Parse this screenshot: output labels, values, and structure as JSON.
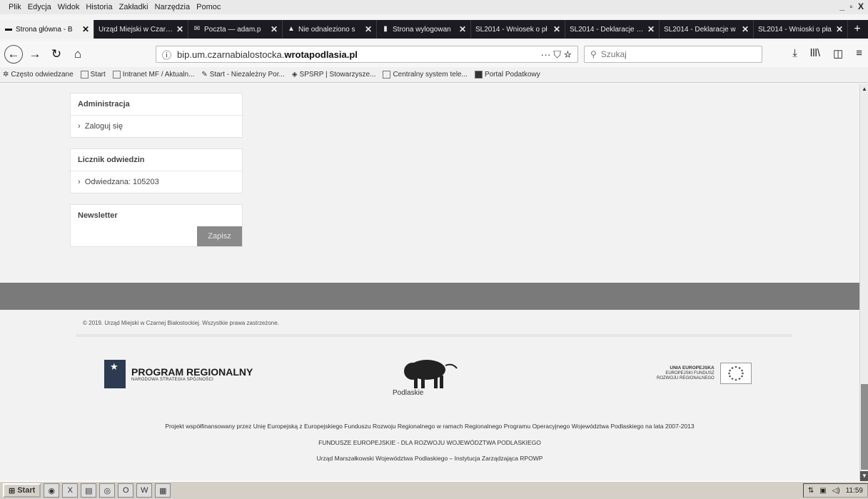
{
  "menubar": {
    "items": [
      "Plik",
      "Edycja",
      "Widok",
      "Historia",
      "Zakładki",
      "Narzędzia",
      "Pomoc"
    ],
    "window_controls": "_ ▫ X"
  },
  "tabs": [
    {
      "label": "Strona główna - B",
      "icon": "page-icon"
    },
    {
      "label": "Urząd Miejski w Czarne",
      "icon": "page-icon"
    },
    {
      "label": "Poczta — adam.p",
      "icon": "mail-icon"
    },
    {
      "label": "Nie odnaleziono s",
      "icon": "warning-icon"
    },
    {
      "label": "Strona wylogowan",
      "icon": "page-icon"
    },
    {
      "label": "SL2014 - Wniosek o pł",
      "icon": "page-icon"
    },
    {
      "label": "SL2014 - Deklaracje wy",
      "icon": "page-icon"
    },
    {
      "label": "SL2014 - Deklaracje w",
      "icon": "page-icon"
    },
    {
      "label": "SL2014 - Wnioski o pła",
      "icon": "page-icon"
    }
  ],
  "newtab_label": "+",
  "url": {
    "prefix": "bip.um.czarnabialostocka.",
    "highlight": "wrotapodlasia.pl",
    "extras": "··· ⛉ ☆"
  },
  "search": {
    "placeholder": "Szukaj"
  },
  "toolbar_right": {
    "download": "⤓",
    "library": "lll\\",
    "sidebar": "◫",
    "menu": "≡"
  },
  "bookmarks": [
    {
      "label": "Często odwiedzane",
      "icon": "gear-icon"
    },
    {
      "label": "Start",
      "icon": "page-icon"
    },
    {
      "label": "Intranet MF / Aktualn...",
      "icon": "page-icon"
    },
    {
      "label": "Start - Niezależny Por...",
      "icon": "page-icon"
    },
    {
      "label": "SPSRP | Stowarzysze...",
      "icon": "page-icon"
    },
    {
      "label": "Centralny system tele...",
      "icon": "page-icon"
    },
    {
      "label": "Portal Podatkowy",
      "icon": "page-icon"
    }
  ],
  "sidebar": {
    "admin": {
      "title": "Administracja",
      "item": "Zaloguj się"
    },
    "counter": {
      "title": "Licznik odwiedzin",
      "item": "Odwiedzana: 105203"
    },
    "newsletter": {
      "title": "Newsletter",
      "button": "Zapisz",
      "placeholder": ""
    }
  },
  "footer": {
    "copyright": "© 2019. Urząd Miejski w Czarnej Białostockiej. Wszystkie prawa zastrzeżone.",
    "logo_pr_title": "PROGRAM REGIONALNY",
    "logo_pr_sub": "NARODOWA STRATEGIA SPÓJNOŚCI",
    "logo_podlaskie": "Podlaskie",
    "logo_ue_1": "UNIA EUROPEJSKA",
    "logo_ue_2": "EUROPEJSKI FUNDUSZ",
    "logo_ue_3": "ROZWOJU REGIONALNEGO",
    "line1": "Projekt współfinansowany przez Unię Europejską z Europejskiego Funduszu Rozwoju Regionalnego w ramach Regionalnego Programu Operacyjnego Województwa Podlaskiego na lata 2007-2013",
    "line2": "FUNDUSZE EUROPEJSKIE - DLA ROZWOJU WOJEWÓDZTWA PODLASKIEGO",
    "line3": "Urząd Marszałkowski Województwa Podlaskiego – Instytucja Zarządzająca RPOWP"
  },
  "taskbar": {
    "start": "Start",
    "apps": [
      "◉",
      "X",
      "▤",
      "◎",
      "O",
      "W",
      "▦"
    ],
    "time": "11:59"
  },
  "colors": {
    "tabbar": "#1c1b22",
    "footer_band": "#7a7a7a",
    "button": "#8a8a8a"
  }
}
